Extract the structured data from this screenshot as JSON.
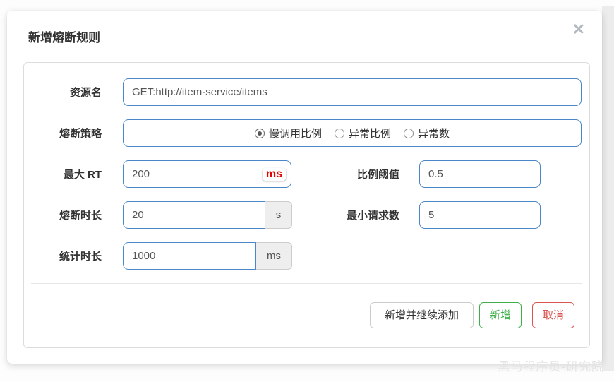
{
  "dialog": {
    "title": "新增熔断规则",
    "close_glyph": "✕"
  },
  "form": {
    "resource": {
      "label": "资源名",
      "value": "GET:http://item-service/items"
    },
    "strategy": {
      "label": "熔断策略",
      "options": [
        {
          "label": "慢调用比例",
          "selected": true
        },
        {
          "label": "异常比例",
          "selected": false
        },
        {
          "label": "异常数",
          "selected": false
        }
      ]
    },
    "max_rt": {
      "label": "最大 RT",
      "value": "200",
      "unit": "ms"
    },
    "ratio_threshold": {
      "label": "比例阈值",
      "value": "0.5"
    },
    "break_duration": {
      "label": "熔断时长",
      "value": "20",
      "unit": "s"
    },
    "min_requests": {
      "label": "最小请求数",
      "value": "5"
    },
    "stat_duration": {
      "label": "统计时长",
      "value": "1000",
      "unit": "ms"
    }
  },
  "footer": {
    "add_and_continue": "新增并继续添加",
    "add": "新增",
    "cancel": "取消"
  },
  "watermark": "黑马程序员-研究院",
  "colors": {
    "input_border": "#4a86c8",
    "unit_red": "#e60000",
    "success_green": "#3fae49",
    "danger_red": "#d9534f",
    "addon_bg": "#eeeeee"
  }
}
